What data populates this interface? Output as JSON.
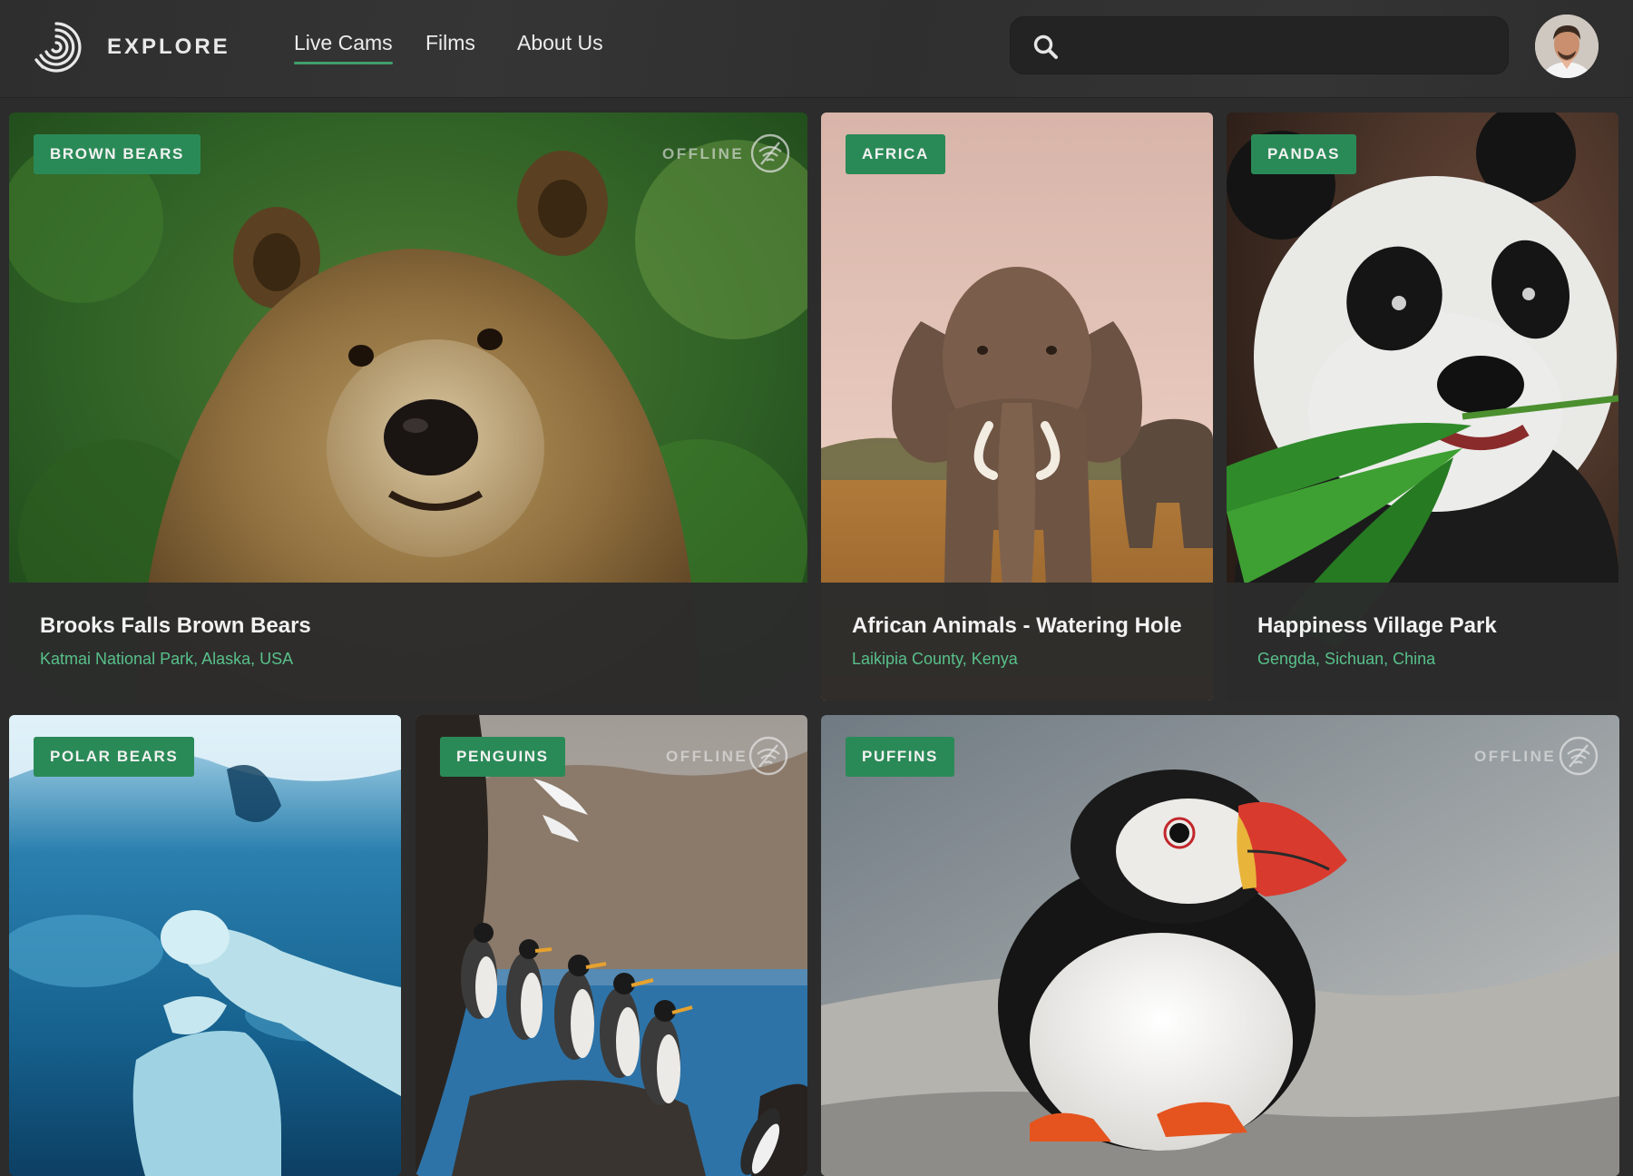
{
  "header": {
    "brand": "EXPLORE",
    "nav": [
      {
        "label": "Live Cams",
        "active": true
      },
      {
        "label": "Films",
        "active": false
      },
      {
        "label": "About Us",
        "active": false
      }
    ],
    "search": {
      "value": "",
      "icon": "search-icon"
    },
    "avatar": "user-avatar"
  },
  "colors": {
    "accent": "#3fa06c",
    "tag": "#2a8a57",
    "location": "#58c08a",
    "background": "#2c2c2c"
  },
  "cards": [
    {
      "tag": "BROWN BEARS",
      "status": "OFFLINE",
      "title": "Brooks Falls Brown Bears",
      "location": "Katmai National Park, Alaska, USA"
    },
    {
      "tag": "AFRICA",
      "status": "",
      "title": "African Animals - Watering Hole",
      "location": "Laikipia County, Kenya"
    },
    {
      "tag": "PANDAS",
      "status": "",
      "title": "Happiness Village Park",
      "location": "Gengda, Sichuan, China"
    },
    {
      "tag": "POLAR BEARS",
      "status": ""
    },
    {
      "tag": "PENGUINS",
      "status": "OFFLINE"
    },
    {
      "tag": "PUFFINS",
      "status": "OFFLINE"
    }
  ]
}
